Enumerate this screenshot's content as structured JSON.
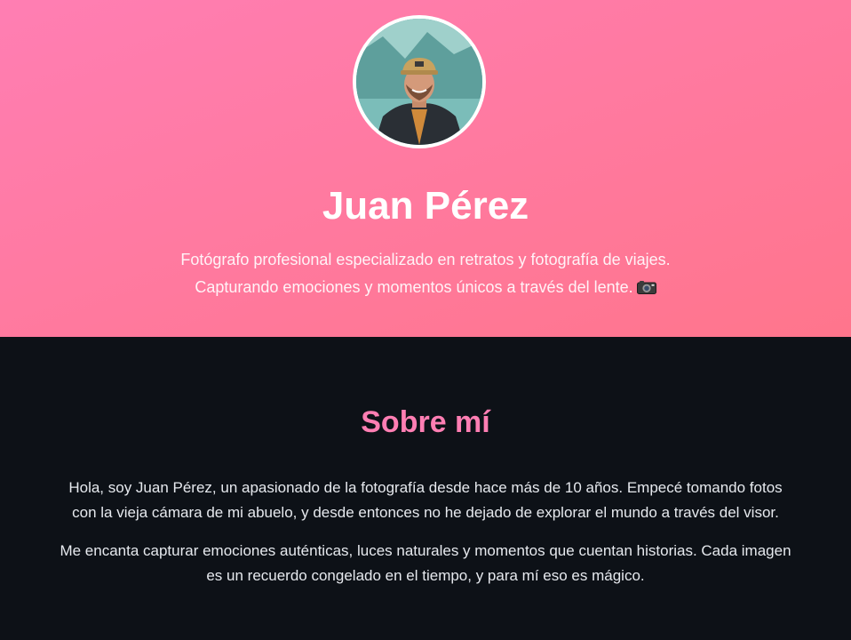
{
  "profile": {
    "avatar_icon": "profile-photo",
    "name": "Juan Pérez",
    "bio_line1": "Fotógrafo profesional especializado en retratos y fotografía de viajes.",
    "bio_line2": "Capturando emociones y momentos únicos a través del lente.",
    "bio_icon": "camera-icon"
  },
  "about": {
    "title": "Sobre mí",
    "paragraph1_line1": "Hola, soy Juan Pérez, un apasionado de la fotografía desde hace más de 10 años. Empecé tomando fotos",
    "paragraph1_line2": "con la vieja cámara de mi abuelo, y desde entonces no he dejado de explorar el mundo a través del visor.",
    "paragraph2_line1": "Me encanta capturar emociones auténticas, luces naturales y momentos que cuentan historias. Cada imagen",
    "paragraph2_line2": "es un recuerdo congelado en el tiempo, y para mí eso es mágico."
  },
  "colors": {
    "hero_start": "#ff7eb3",
    "hero_end": "#ff758c",
    "background_dark": "#0d1117",
    "accent_pink": "#ff7eb3",
    "text_light": "#e6e9ee"
  }
}
